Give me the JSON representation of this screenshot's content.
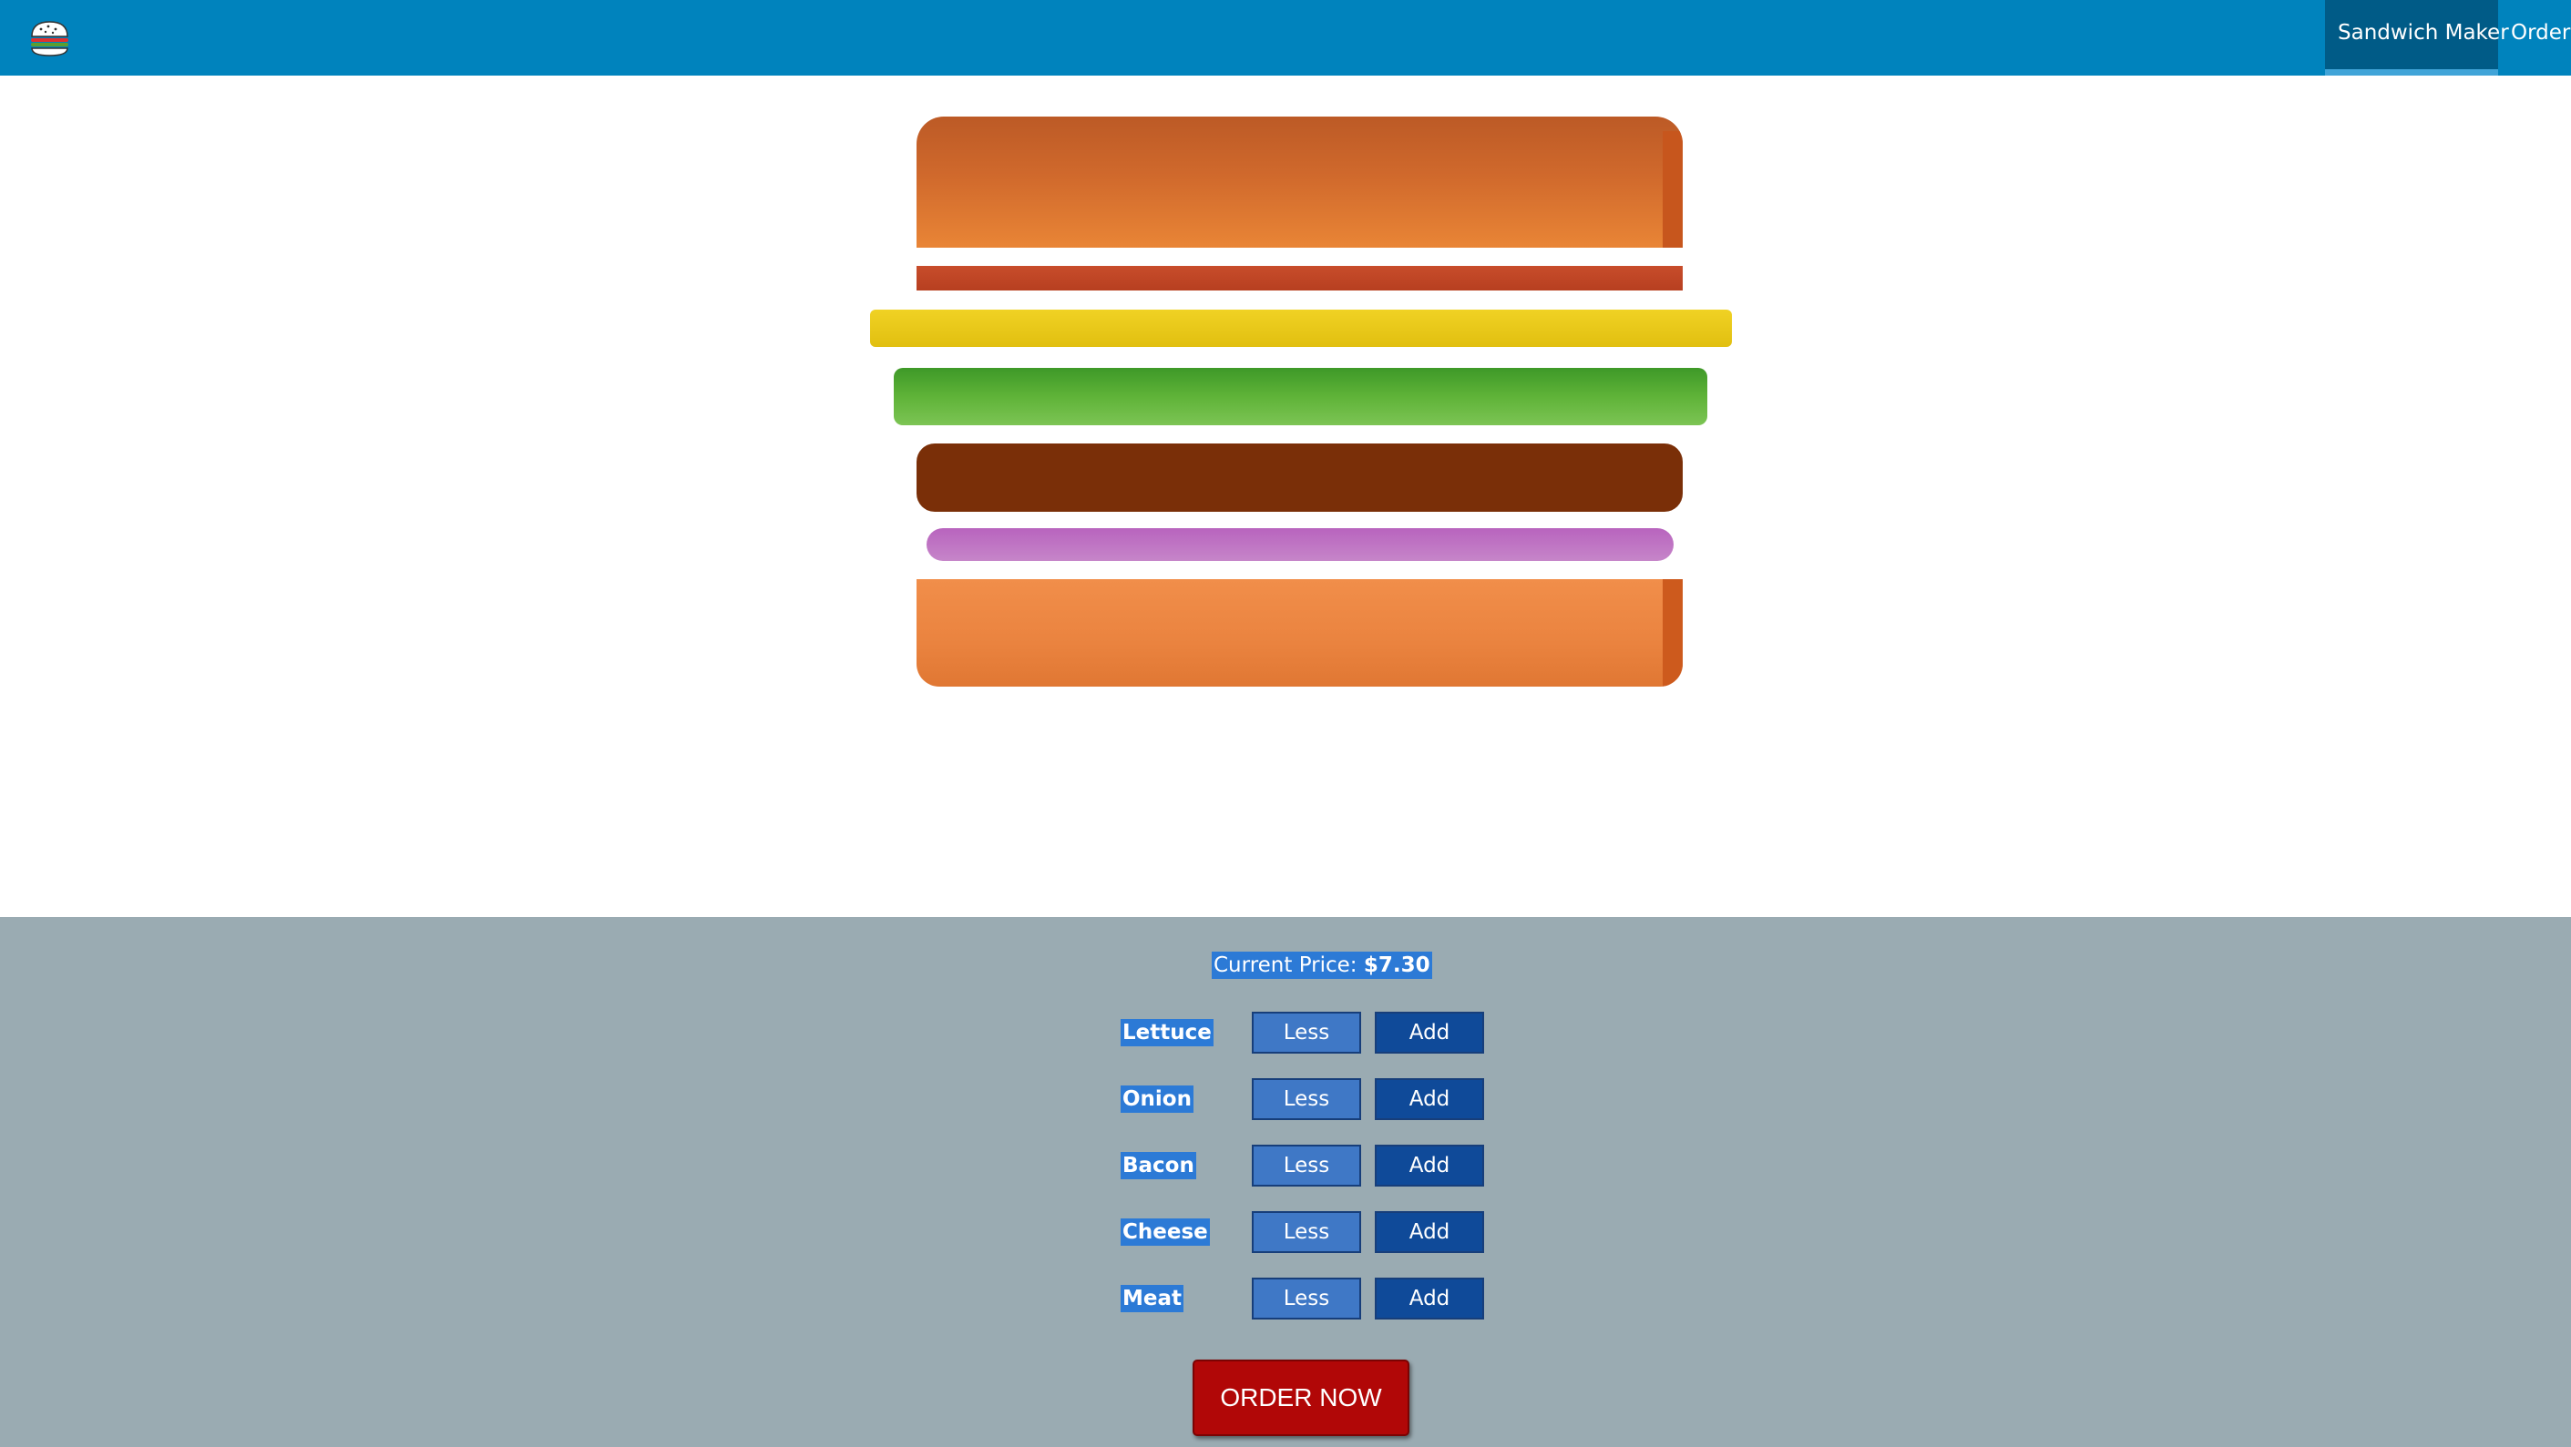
{
  "header": {
    "logo": "burger-logo",
    "nav": [
      {
        "label": "Sandwich Maker",
        "active": true
      },
      {
        "label": "Orders",
        "active": false
      }
    ],
    "background_color": "#0083bd"
  },
  "sandwich": {
    "layers": [
      "bread-top",
      "bacon",
      "cheese",
      "lettuce",
      "meat",
      "onion",
      "bread-bottom"
    ]
  },
  "controls": {
    "price_label": "Current Price:",
    "price_value": "$7.30",
    "ingredients": [
      {
        "name": "Lettuce",
        "less_label": "Less",
        "add_label": "Add"
      },
      {
        "name": "Onion",
        "less_label": "Less",
        "add_label": "Add"
      },
      {
        "name": "Bacon",
        "less_label": "Less",
        "add_label": "Add"
      },
      {
        "name": "Cheese",
        "less_label": "Less",
        "add_label": "Add"
      },
      {
        "name": "Meat",
        "less_label": "Less",
        "add_label": "Add"
      }
    ],
    "order_label": "ORDER NOW",
    "order_color": "#b10707"
  }
}
